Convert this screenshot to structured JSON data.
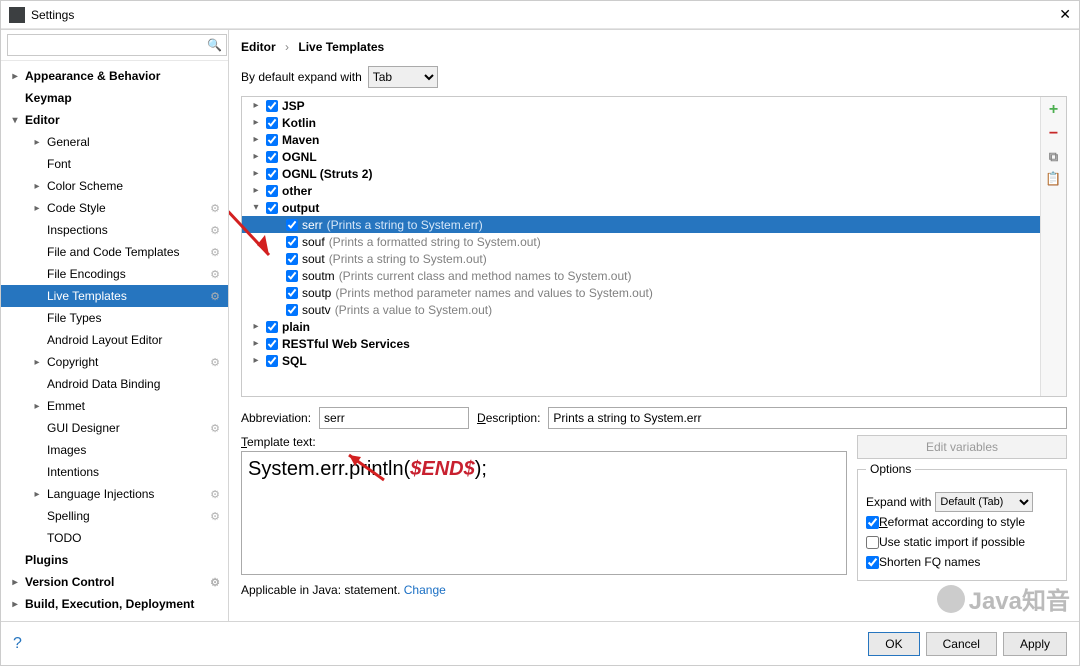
{
  "title": "Settings",
  "search_placeholder": "",
  "sidebar": {
    "items": [
      {
        "label": "Appearance & Behavior",
        "bold": true,
        "exp": ">"
      },
      {
        "label": "Keymap",
        "bold": true,
        "exp": ""
      },
      {
        "label": "Editor",
        "bold": true,
        "exp": "v"
      },
      {
        "label": "General",
        "indent": true,
        "exp": ">"
      },
      {
        "label": "Font",
        "indent": true,
        "exp": ""
      },
      {
        "label": "Color Scheme",
        "indent": true,
        "exp": ">"
      },
      {
        "label": "Code Style",
        "indent": true,
        "exp": ">",
        "gear": true
      },
      {
        "label": "Inspections",
        "indent": true,
        "exp": "",
        "gear": true
      },
      {
        "label": "File and Code Templates",
        "indent": true,
        "exp": "",
        "gear": true
      },
      {
        "label": "File Encodings",
        "indent": true,
        "exp": "",
        "gear": true
      },
      {
        "label": "Live Templates",
        "indent": true,
        "exp": "",
        "gear": true,
        "selected": true
      },
      {
        "label": "File Types",
        "indent": true,
        "exp": ""
      },
      {
        "label": "Android Layout Editor",
        "indent": true,
        "exp": ""
      },
      {
        "label": "Copyright",
        "indent": true,
        "exp": ">",
        "gear": true
      },
      {
        "label": "Android Data Binding",
        "indent": true,
        "exp": ""
      },
      {
        "label": "Emmet",
        "indent": true,
        "exp": ">"
      },
      {
        "label": "GUI Designer",
        "indent": true,
        "exp": "",
        "gear": true
      },
      {
        "label": "Images",
        "indent": true,
        "exp": ""
      },
      {
        "label": "Intentions",
        "indent": true,
        "exp": ""
      },
      {
        "label": "Language Injections",
        "indent": true,
        "exp": ">",
        "gear": true
      },
      {
        "label": "Spelling",
        "indent": true,
        "exp": "",
        "gear": true
      },
      {
        "label": "TODO",
        "indent": true,
        "exp": ""
      },
      {
        "label": "Plugins",
        "bold": true,
        "exp": ""
      },
      {
        "label": "Version Control",
        "bold": true,
        "exp": ">",
        "gear": true
      },
      {
        "label": "Build, Execution, Deployment",
        "bold": true,
        "exp": ">"
      }
    ]
  },
  "breadcrumb": {
    "a": "Editor",
    "b": "Live Templates"
  },
  "expand": {
    "label": "By default expand with",
    "value": "Tab"
  },
  "groups": [
    {
      "name": "JSP",
      "exp": ">"
    },
    {
      "name": "Kotlin",
      "exp": ">"
    },
    {
      "name": "Maven",
      "exp": ">"
    },
    {
      "name": "OGNL",
      "exp": ">"
    },
    {
      "name": "OGNL (Struts 2)",
      "exp": ">"
    },
    {
      "name": "other",
      "exp": ">"
    },
    {
      "name": "output",
      "exp": "v",
      "children": [
        {
          "name": "serr",
          "desc": "(Prints a string to System.err)",
          "sel": true
        },
        {
          "name": "souf",
          "desc": "(Prints a formatted string to System.out)"
        },
        {
          "name": "sout",
          "desc": "(Prints a string to System.out)"
        },
        {
          "name": "soutm",
          "desc": "(Prints current class and method names to System.out)"
        },
        {
          "name": "soutp",
          "desc": "(Prints method parameter names and values to System.out)"
        },
        {
          "name": "soutv",
          "desc": "(Prints a value to System.out)"
        }
      ]
    },
    {
      "name": "plain",
      "exp": ">"
    },
    {
      "name": "RESTful Web Services",
      "exp": ">"
    },
    {
      "name": "SQL",
      "exp": ">"
    }
  ],
  "abbrev": {
    "label": "Abbreviation:",
    "value": "serr"
  },
  "desc": {
    "label": "Description:",
    "value": "Prints a string to System.err"
  },
  "template_label": "Template text:",
  "template_text_pre": "System.err.println(",
  "template_text_var": "$END$",
  "template_text_post": ");",
  "editvars": "Edit variables",
  "options": {
    "title": "Options",
    "expand_label": "Expand with",
    "expand_value": "Default (Tab)",
    "reformat": "Reformat according to style",
    "static": "Use static import if possible",
    "shorten": "Shorten FQ names"
  },
  "applicable": {
    "text": "Applicable in Java: statement. ",
    "link": "Change"
  },
  "buttons": {
    "ok": "OK",
    "cancel": "Cancel",
    "apply": "Apply"
  },
  "watermark": "Java知音"
}
